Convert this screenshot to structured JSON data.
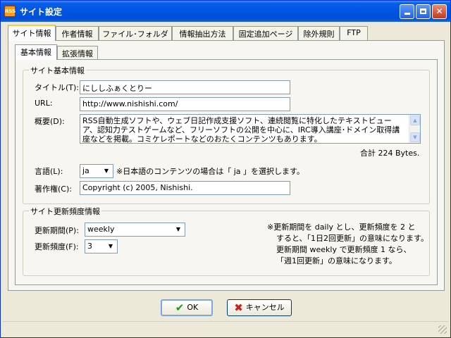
{
  "window": {
    "title": "サイト設定",
    "app_icon_text": "RSS",
    "controls": {
      "minimize": "",
      "maximize": "",
      "close": "✕"
    }
  },
  "tabs": [
    {
      "label": "サイト情報",
      "active": true
    },
    {
      "label": "作者情報"
    },
    {
      "label": "ファイル･フォルダ"
    },
    {
      "label": "情報抽出方法"
    },
    {
      "label": "固定追加ページ"
    },
    {
      "label": "除外規則"
    },
    {
      "label": "FTP"
    }
  ],
  "subtabs": [
    {
      "label": "基本情報",
      "active": true
    },
    {
      "label": "拡張情報"
    }
  ],
  "basic": {
    "group_title": "サイト基本情報",
    "title_label": "タイトル(T):",
    "title_value": "にししふぁくとりー",
    "url_label": "URL:",
    "url_value": "http://www.nishishi.com/",
    "summary_label": "概要(D):",
    "summary_value": "RSS自動生成ソフトや、ウェブ日記作成支援ソフト、連続閲覧に特化したテキストビューア、認知力テストゲームなど、フリーソフトの公開を中心に、IRC導入講座･ドメイン取得講座などを掲載。コミケレポートなどのおたくコンテンツもあります。",
    "summary_count": "合計 224 Bytes.",
    "language_label": "言語(L):",
    "language_value": "ja",
    "language_note": "※日本語のコンテンツの場合は「 ja 」を選択します。",
    "copyright_label": "著作権(C):",
    "copyright_value": "Copyright (c) 2005, Nishishi."
  },
  "update": {
    "group_title": "サイト更新頻度情報",
    "period_label": "更新期間(P):",
    "period_value": "weekly",
    "freq_label": "更新頻度(F):",
    "freq_value": "3",
    "note_lines": [
      "※更新期間を daily とし、更新頻度を 2 と",
      "すると、「1日2回更新」の意味になります。",
      "更新期間 weekly で更新頻度 1 なら、",
      "「週1回更新」の意味になります。"
    ]
  },
  "buttons": {
    "ok": "OK",
    "cancel": "キャンセル"
  },
  "colors": {
    "title_bar": "#0054e3",
    "dialog_bg": "#ece9d8",
    "ok_check": "#1e9a1e",
    "cancel_x": "#c8201e"
  }
}
